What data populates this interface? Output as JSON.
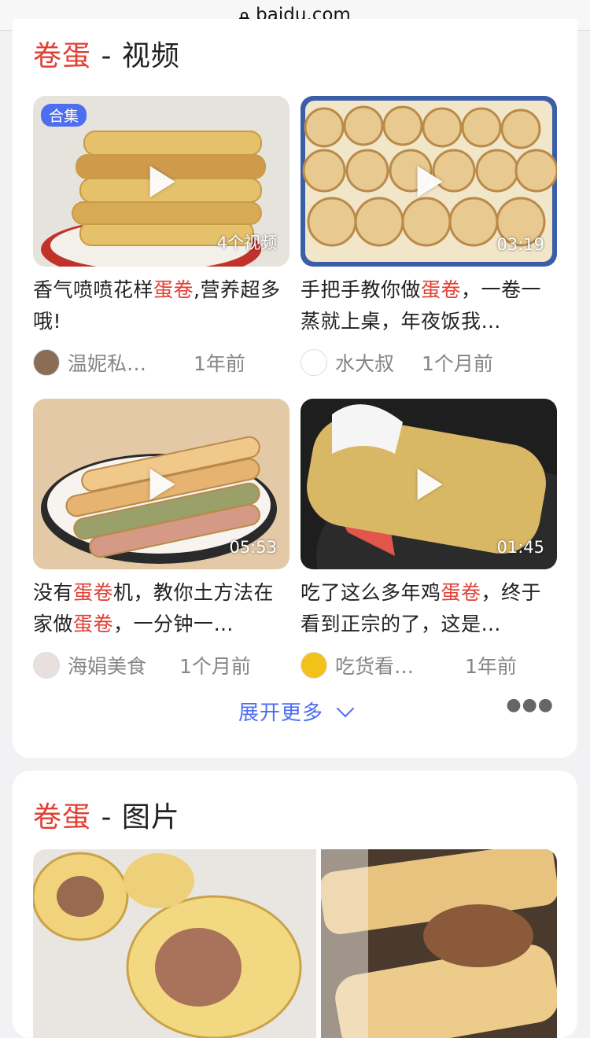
{
  "url": "baidu.com",
  "video_section": {
    "keyword": "卷蛋",
    "suffix": " - 视频",
    "more_label": "展开更多",
    "videos": [
      {
        "tag": "合集",
        "duration": "4个视频",
        "title_pre": "香气喷喷花样",
        "title_kw": "蛋卷",
        "title_post": ",营养超多哦!",
        "author": "温妮私…",
        "time": "1年前"
      },
      {
        "tag": "",
        "duration": "03:19",
        "title_pre": "手把手教你做",
        "title_kw": "蛋卷",
        "title_post": "，一卷一蒸就上桌，年夜饭我…",
        "author": "水大叔",
        "time": "1个月前"
      },
      {
        "tag": "",
        "duration": "05:53",
        "title_pre": "没有",
        "title_kw": "蛋卷",
        "title_mid": "机，教你土方法在家做",
        "title_kw2": "蛋卷",
        "title_post": "，一分钟一…",
        "author": "海娟美食",
        "time": "1个月前"
      },
      {
        "tag": "",
        "duration": "01:45",
        "title_pre": "吃了这么多年鸡",
        "title_kw": "蛋卷",
        "title_post": "，终于看到正宗的了，这是…",
        "author": "吃货看…",
        "time": "1年前"
      }
    ]
  },
  "image_section": {
    "keyword": "卷蛋",
    "suffix": " - 图片"
  },
  "colors": {
    "keyword_red": "#e33e33",
    "link_blue": "#4e6ef2"
  }
}
